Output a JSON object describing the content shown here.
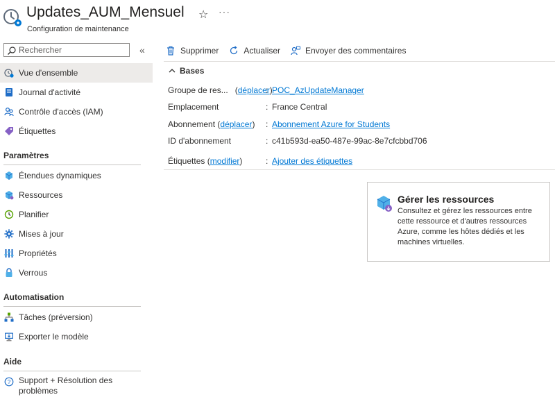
{
  "header": {
    "title": "Updates_AUM_Mensuel",
    "subtitle": "Configuration de maintenance",
    "icon": "maintenance-clock-icon",
    "favorite_glyph": "☆",
    "more_glyph": "···"
  },
  "sidebar": {
    "search_placeholder": "Rechercher",
    "collapse_glyph": "«",
    "items": [
      {
        "label": "Vue d'ensemble",
        "icon": "overview-icon"
      },
      {
        "label": "Journal d'activité",
        "icon": "activity-log-icon"
      },
      {
        "label": "Contrôle d'accès (IAM)",
        "icon": "iam-people-icon"
      },
      {
        "label": "Étiquettes",
        "icon": "tag-icon"
      }
    ],
    "sections": [
      {
        "title": "Paramètres",
        "items": [
          {
            "label": "Étendues dynamiques",
            "icon": "dynamic-scopes-icon"
          },
          {
            "label": "Ressources",
            "icon": "resources-cube-icon"
          },
          {
            "label": "Planifier",
            "icon": "schedule-clock-icon"
          },
          {
            "label": "Mises à jour",
            "icon": "updates-gear-icon"
          },
          {
            "label": "Propriétés",
            "icon": "properties-bars-icon"
          },
          {
            "label": "Verrous",
            "icon": "lock-icon"
          }
        ]
      },
      {
        "title": "Automatisation",
        "items": [
          {
            "label": "Tâches (préversion)",
            "icon": "tasks-tree-icon"
          },
          {
            "label": "Exporter le modèle",
            "icon": "export-template-icon"
          }
        ]
      },
      {
        "title": "Aide",
        "items": [
          {
            "label": "Support + Résolution des problèmes",
            "icon": "help-question-icon"
          }
        ]
      }
    ]
  },
  "toolbar": {
    "delete_label": "Supprimer",
    "refresh_label": "Actualiser",
    "feedback_label": "Envoyer des commentaires"
  },
  "essentials": {
    "section_label": "Bases",
    "separator": ":",
    "resource_group": {
      "label": "Groupe de res...",
      "action": "déplacer",
      "value": "POC_AzUpdateManager"
    },
    "location": {
      "label": "Emplacement",
      "value": "France Central"
    },
    "subscription": {
      "label": "Abonnement",
      "action": "déplacer",
      "value": "Abonnement Azure for Students"
    },
    "subscription_id": {
      "label": "ID d'abonnement",
      "value": "c41b593d-ea50-487e-99ac-8e7cfcbbd706"
    },
    "tags": {
      "label": "Étiquettes",
      "action": "modifier",
      "value": "Ajouter des étiquettes"
    }
  },
  "card": {
    "title": "Gérer les ressources",
    "description": "Consultez et gérez les ressources entre cette ressource et d'autres ressources Azure, comme les hôtes dédiés et les machines virtuelles.",
    "icon": "manage-resources-cube-icon"
  },
  "colors": {
    "link": "#0078d4",
    "active_nav_bg": "#edebe9",
    "text": "#323130"
  }
}
